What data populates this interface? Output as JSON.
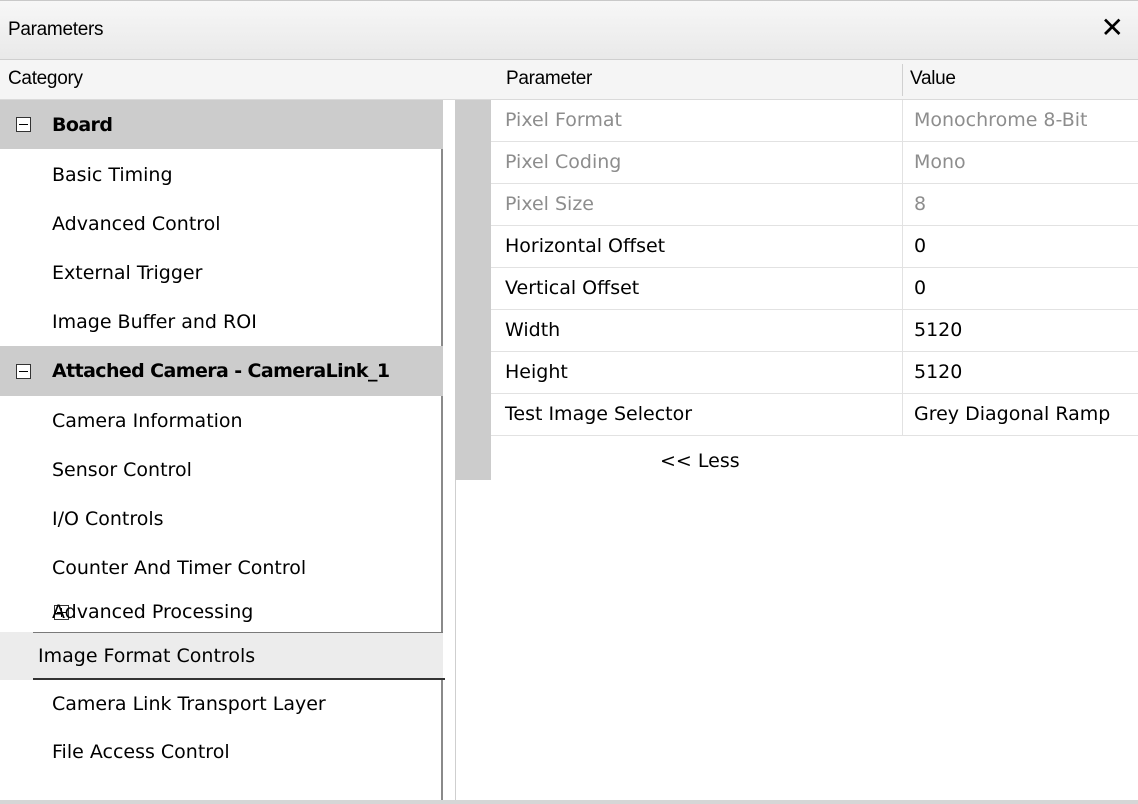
{
  "window": {
    "title": "Parameters",
    "close_glyph": "✕"
  },
  "headers": {
    "category": "Category",
    "parameter": "Parameter",
    "value": "Value"
  },
  "categories": [
    {
      "label": "Board",
      "kind": "group",
      "expander": "minus"
    },
    {
      "label": "Basic Timing",
      "kind": "item"
    },
    {
      "label": "Advanced Control",
      "kind": "item"
    },
    {
      "label": "External Trigger",
      "kind": "item"
    },
    {
      "label": "Image Buffer and ROI",
      "kind": "item"
    },
    {
      "label": "Attached Camera - CameraLink_1",
      "kind": "group",
      "expander": "minus"
    },
    {
      "label": "Camera Information",
      "kind": "item"
    },
    {
      "label": "Sensor Control",
      "kind": "item"
    },
    {
      "label": "I/O Controls",
      "kind": "item"
    },
    {
      "label": "Counter And Timer Control",
      "kind": "item"
    },
    {
      "label": "Advanced Processing",
      "kind": "subgroup",
      "expander": "plus"
    },
    {
      "label": "Image Format Controls",
      "kind": "selected"
    },
    {
      "label": "Camera Link Transport Layer",
      "kind": "item"
    },
    {
      "label": "File Access Control",
      "kind": "item"
    }
  ],
  "parameters": [
    {
      "name": "Pixel Format",
      "value": "Monochrome 8-Bit",
      "disabled": true
    },
    {
      "name": "Pixel Coding",
      "value": "Mono",
      "disabled": true
    },
    {
      "name": "Pixel Size",
      "value": "8",
      "disabled": true
    },
    {
      "name": "Horizontal Offset",
      "value": "0",
      "disabled": false
    },
    {
      "name": "Vertical Offset",
      "value": "0",
      "disabled": false
    },
    {
      "name": "Width",
      "value": "5120",
      "disabled": false
    },
    {
      "name": "Height",
      "value": "5120",
      "disabled": false
    },
    {
      "name": "Test Image Selector",
      "value": "Grey Diagonal Ramp",
      "disabled": false
    }
  ],
  "less_link": "<< Less",
  "colors": {
    "group_bg": "#cccccc",
    "disabled_text": "#8d8d8d",
    "selected_bg": "#ececec"
  }
}
